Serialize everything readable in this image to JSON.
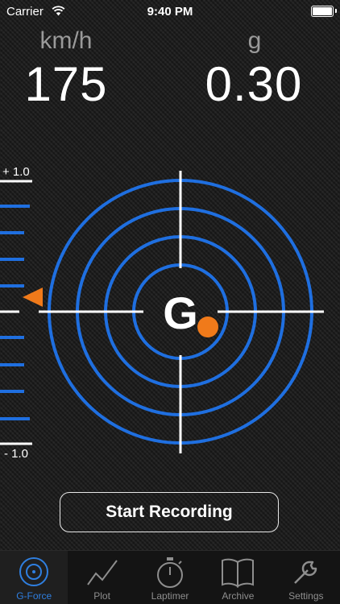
{
  "status_bar": {
    "carrier": "Carrier",
    "time": "9:40 PM"
  },
  "readouts": {
    "speed": {
      "unit": "km/h",
      "value": "175"
    },
    "gforce": {
      "unit": "g",
      "value": "0.30"
    }
  },
  "scale": {
    "top_label": "+ 1.0",
    "bottom_label": "- 1.0"
  },
  "gauge": {
    "center_label": "G",
    "ring_color": "#1f6fe0",
    "marker_color": "#f07a1a"
  },
  "actions": {
    "start_recording": "Start Recording"
  },
  "tabs": [
    {
      "label": "G-Force",
      "icon": "target-icon",
      "active": true
    },
    {
      "label": "Plot",
      "icon": "plot-icon",
      "active": false
    },
    {
      "label": "Laptimer",
      "icon": "stopwatch-icon",
      "active": false
    },
    {
      "label": "Archive",
      "icon": "book-icon",
      "active": false
    },
    {
      "label": "Settings",
      "icon": "wrench-icon",
      "active": false
    }
  ],
  "colors": {
    "accent": "#2f7fe0",
    "ring": "#1f6fe0",
    "marker": "#f07a1a"
  }
}
